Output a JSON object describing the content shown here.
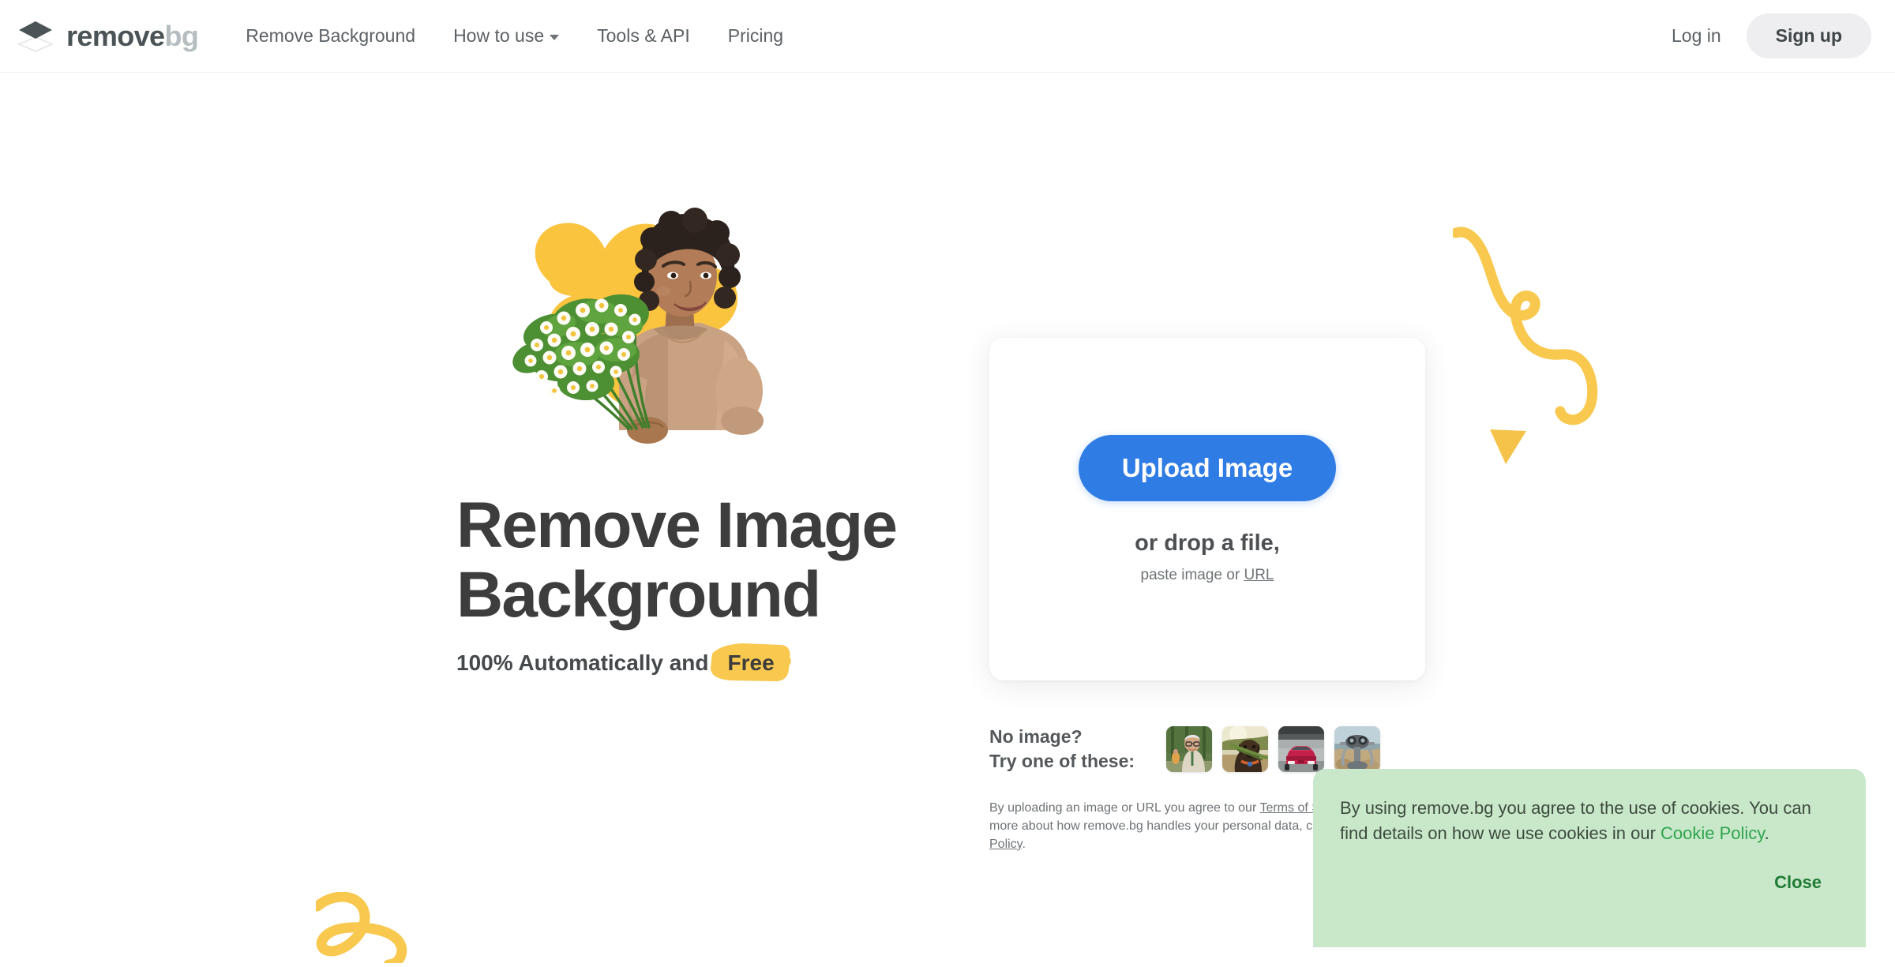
{
  "header": {
    "logo": {
      "icon": "layers-diamond-icon",
      "text_dark": "remove",
      "text_light": "bg"
    },
    "nav": [
      {
        "label": "Remove Background",
        "has_chevron": false
      },
      {
        "label": "How to use",
        "has_chevron": true
      },
      {
        "label": "Tools & API",
        "has_chevron": false
      },
      {
        "label": "Pricing",
        "has_chevron": false
      }
    ],
    "login_label": "Log in",
    "signup_label": "Sign up"
  },
  "hero": {
    "title_line1": "Remove Image",
    "title_line2": "Background",
    "subtitle_prefix": "100% Automatically and",
    "subtitle_highlight": "Free",
    "image_alt": "woman-with-flowers-photo"
  },
  "upload": {
    "button_label": "Upload Image",
    "drop_label": "or drop a file,",
    "paste_prefix": "paste image or",
    "paste_link": "URL"
  },
  "samples": {
    "label_line1": "No image?",
    "label_line2": "Try one of these:",
    "thumbnails": [
      {
        "name": "sample-man-vineyard"
      },
      {
        "name": "sample-dog-stick"
      },
      {
        "name": "sample-red-car"
      },
      {
        "name": "sample-viewing-binocular"
      }
    ]
  },
  "fineprint": {
    "part1": "By uploading an image or URL you agree to our ",
    "terms_link": "Terms of Service",
    "part2": ". To learn more about how remove.bg handles your personal data, check our ",
    "privacy_link": "Privacy Policy",
    "part3": "."
  },
  "cookie": {
    "text_part1": "By using remove.bg you agree to the use of cookies. You can find details on how we use cookies in our ",
    "policy_link": "Cookie Policy",
    "text_part2": ".",
    "close_label": "Close"
  },
  "colors": {
    "accent_blue": "#2f7ce5",
    "brand_yellow": "#f9c84e",
    "cookie_bg": "#c9e8ca",
    "cookie_green": "#2ea44f",
    "heading_gray": "#3d3d3d",
    "signup_bg": "#eeeef0"
  }
}
